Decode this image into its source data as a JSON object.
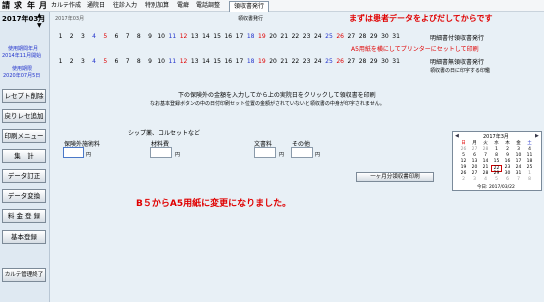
{
  "menu": {
    "main": [
      "請",
      "求",
      "年",
      "月"
    ],
    "items": [
      "カルテ作成",
      "通院日",
      "往診入力",
      "特別加算",
      "電癖",
      "電話調整",
      "領収書発行"
    ]
  },
  "sidebar": {
    "year_month": "2017年03月",
    "label_start": "使用期間年月",
    "start_date": "2014年11月開始",
    "label_end": "使用期限",
    "end_date": "2020年07月5日",
    "buttons": [
      "レセプト削除",
      "戻りレセ追加",
      "印刷メニュー",
      "集　計",
      "データ訂正",
      "データ変換",
      "料 金 登 録",
      "基本登録",
      "カルテ管理終了"
    ],
    "up_arrow": "▲",
    "down_arrow": "▼"
  },
  "header": {
    "month_small": "2017年03月",
    "receipt_title": "領収書発行",
    "red_notice": "まずは患者データをよびだしてからです"
  },
  "row1": {
    "days": [
      "1",
      "2",
      "3",
      "4",
      "5",
      "6",
      "7",
      "8",
      "9",
      "10",
      "11",
      "12",
      "13",
      "14",
      "15",
      "16",
      "17",
      "18",
      "19",
      "20",
      "21",
      "22",
      "23",
      "24",
      "25",
      "26",
      "27",
      "28",
      "29",
      "30",
      "31"
    ],
    "label": "明細書付領収書発行"
  },
  "row2": {
    "days": [
      "1",
      "2",
      "3",
      "4",
      "5",
      "6",
      "7",
      "8",
      "9",
      "10",
      "11",
      "12",
      "13",
      "14",
      "15",
      "16",
      "17",
      "18",
      "19",
      "20",
      "21",
      "22",
      "23",
      "24",
      "25",
      "26",
      "27",
      "28",
      "29",
      "30",
      "31"
    ],
    "label": "明細書無領収書発行",
    "sub_label": "領収書の日に印字する印鑑"
  },
  "a5_notice": "A5用紙を横にしてプリンターにセットして印刷",
  "instructions": {
    "line1": "下の保険外の金額を入力してから上の実院日をクリックして領収書を印刷",
    "line2": "なお基本登録ボタンの中の日付印刷セット位置の金額がされていないと領収書の中身が印字されません。"
  },
  "fields": {
    "note": "シップ薬、コルセットなど",
    "insurance_label": "保険外施術料",
    "materials_label": "材料費",
    "document_label": "文書料",
    "other_label": "その他",
    "yen": "円"
  },
  "print_button": "一ヶ月分領収書印刷",
  "bottom_notice": "B５からA5用紙に変更になりました。",
  "calendar": {
    "title": "2017年3月",
    "weekdays": [
      "日",
      "月",
      "火",
      "水",
      "木",
      "金",
      "土"
    ],
    "rows": [
      [
        "26",
        "27",
        "28",
        "1",
        "2",
        "3",
        "4"
      ],
      [
        "5",
        "6",
        "7",
        "8",
        "9",
        "10",
        "11"
      ],
      [
        "12",
        "13",
        "14",
        "15",
        "16",
        "17",
        "18"
      ],
      [
        "19",
        "20",
        "21",
        "22",
        "23",
        "24",
        "25"
      ],
      [
        "26",
        "27",
        "28",
        "29",
        "30",
        "31",
        "1"
      ],
      [
        "2",
        "3",
        "4",
        "5",
        "6",
        "7",
        "8"
      ]
    ],
    "today": "今日: 2017/03/22",
    "prev": "◀",
    "next": "▶"
  }
}
